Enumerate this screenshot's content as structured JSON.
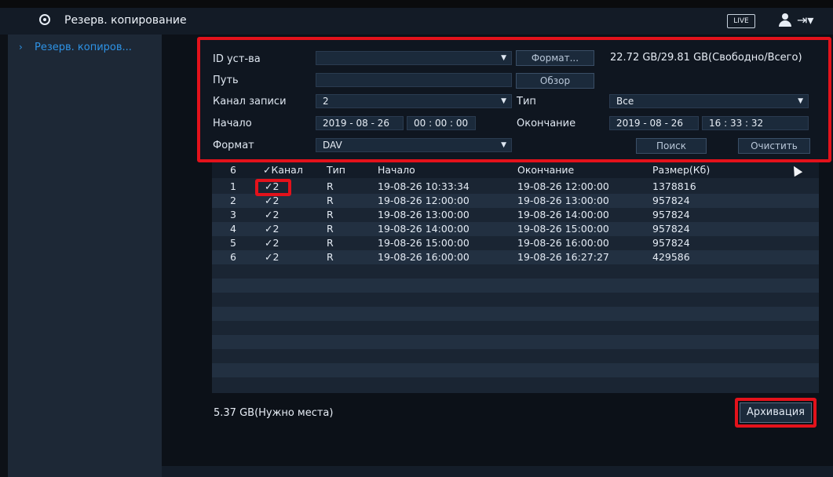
{
  "header": {
    "title": "Резерв. копирование",
    "live_label": "LIVE",
    "icons": [
      "user-icon",
      "logout-icon"
    ]
  },
  "sidebar": {
    "items": [
      {
        "label": "Резерв. копиров..."
      }
    ]
  },
  "form": {
    "device_label": "ID уст-ва",
    "device_value": "",
    "format_button": "Формат...",
    "storage_info": "22.72 GB/29.81 GB(Свободно/Всего)",
    "path_label": "Путь",
    "path_value": "",
    "browse_button": "Обзор",
    "channel_label": "Канал записи",
    "channel_value": "2",
    "type_label": "Тип",
    "type_value": "Все",
    "start_label": "Начало",
    "start_date": "2019 - 08 - 26",
    "start_time": "00 : 00 : 00",
    "end_label": "Окончание",
    "end_date": "2019 - 08 - 26",
    "end_time": "16 : 33 : 32",
    "format_label": "Формат",
    "format_value": "DAV",
    "search_button": "Поиск",
    "clear_button": "Очистить"
  },
  "table": {
    "headers": [
      "6",
      "✓Канал",
      "Тип",
      "Начало",
      "Окончание",
      "Размер(Кб)"
    ],
    "rows": [
      [
        "1",
        "✓2",
        "R",
        "19-08-26 10:33:34",
        "19-08-26 12:00:00",
        "1378816"
      ],
      [
        "2",
        "✓2",
        "R",
        "19-08-26 12:00:00",
        "19-08-26 13:00:00",
        "957824"
      ],
      [
        "3",
        "✓2",
        "R",
        "19-08-26 13:00:00",
        "19-08-26 14:00:00",
        "957824"
      ],
      [
        "4",
        "✓2",
        "R",
        "19-08-26 14:00:00",
        "19-08-26 15:00:00",
        "957824"
      ],
      [
        "5",
        "✓2",
        "R",
        "19-08-26 15:00:00",
        "19-08-26 16:00:00",
        "957824"
      ],
      [
        "6",
        "✓2",
        "R",
        "19-08-26 16:00:00",
        "19-08-26 16:27:27",
        "429586"
      ]
    ]
  },
  "footer": {
    "space_needed": "5.37 GB(Нужно места)",
    "backup_button": "Архивация"
  },
  "colors": {
    "accent": "#2e93e6",
    "highlight": "#e3121b"
  }
}
